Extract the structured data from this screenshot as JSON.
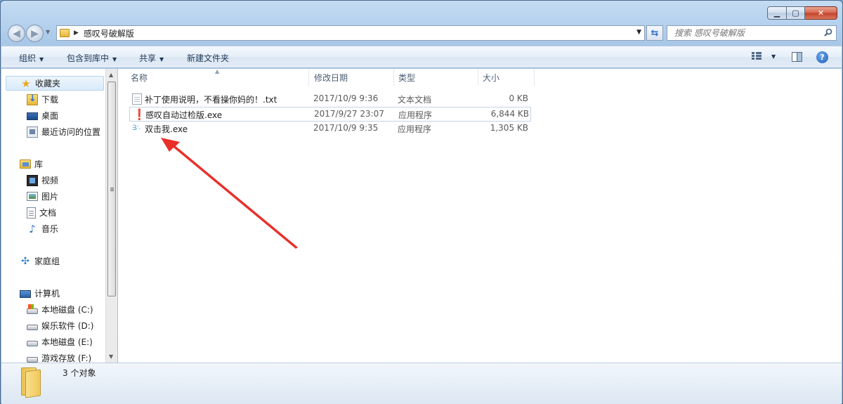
{
  "address": {
    "crumb": "感叹号破解版"
  },
  "search": {
    "placeholder": "搜索 感叹号破解版"
  },
  "toolbar": {
    "organize": "组织",
    "include_in_library": "包含到库中",
    "share": "共享",
    "new_folder": "新建文件夹"
  },
  "navpane": {
    "favorites": "收藏夹",
    "downloads": "下载",
    "desktop": "桌面",
    "recent": "最近访问的位置",
    "libraries": "库",
    "videos": "视频",
    "pictures": "图片",
    "documents": "文档",
    "music": "音乐",
    "homegroup": "家庭组",
    "computer": "计算机",
    "drives": [
      "本地磁盘 (C:)",
      "娱乐软件 (D:)",
      "本地磁盘 (E:)",
      "游戏存放 (F:)"
    ]
  },
  "columns": {
    "name": "名称",
    "date": "修改日期",
    "type": "类型",
    "size": "大小"
  },
  "files": [
    {
      "name": "补丁使用说明，不看操你妈的！.txt",
      "date": "2017/10/9 9:36",
      "type": "文本文档",
      "size": "0 KB"
    },
    {
      "name": "感叹自动过检版.exe",
      "date": "2017/9/27 23:07",
      "type": "应用程序",
      "size": "6,844 KB"
    },
    {
      "name": "双击我.exe",
      "date": "2017/10/9 9:35",
      "type": "应用程序",
      "size": "1,305 KB"
    }
  ],
  "status": {
    "count": "3 个对象"
  },
  "colors": {
    "arrow": "#e8302b",
    "window_frame": "#a9c8e8"
  }
}
